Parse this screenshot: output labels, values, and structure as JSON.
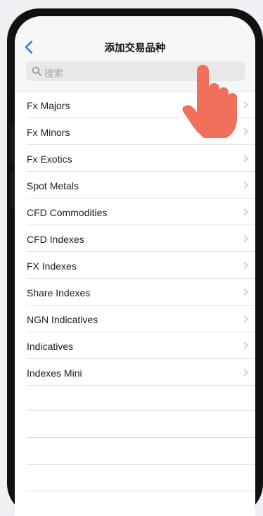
{
  "header": {
    "title": "添加交易品种",
    "back_icon": "chevron-left-icon"
  },
  "search": {
    "placeholder": "搜索",
    "icon": "search-icon"
  },
  "list": {
    "items": [
      {
        "label": "Fx Majors"
      },
      {
        "label": "Fx Minors"
      },
      {
        "label": "Fx Exotics"
      },
      {
        "label": "Spot Metals"
      },
      {
        "label": "CFD Commodities"
      },
      {
        "label": "CFD Indexes"
      },
      {
        "label": "FX Indexes"
      },
      {
        "label": "Share Indexes"
      },
      {
        "label": "NGN Indicatives"
      },
      {
        "label": "Indicatives"
      },
      {
        "label": "Indexes Mini"
      }
    ],
    "chevron_icon": "chevron-right-icon"
  },
  "overlay": {
    "icon": "pointing-hand-icon",
    "color": "#f0705c"
  },
  "colors": {
    "accent": "#1a7cf5",
    "nav_background": "#f7f7f7",
    "separator": "#e1e1e3"
  }
}
